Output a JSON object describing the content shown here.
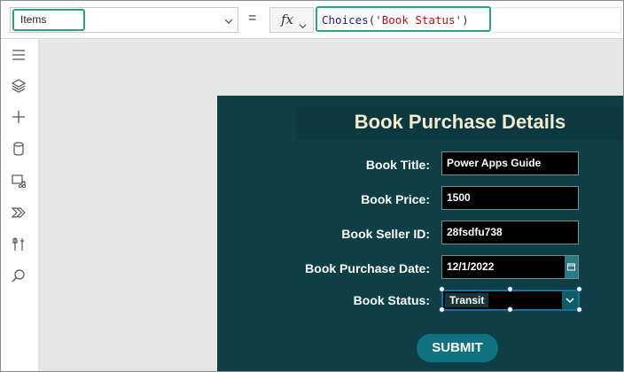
{
  "formula_bar": {
    "property_value": "Items",
    "equals": "=",
    "fx_label": "fx",
    "formula": {
      "function": "Choices",
      "open": "(",
      "argument": "'Book Status'",
      "close": ")"
    }
  },
  "left_rail": {
    "icons": [
      "menu-icon",
      "layers-icon",
      "add-icon",
      "data-icon",
      "media-icon",
      "power-automate-icon",
      "tools-icon",
      "search-icon"
    ]
  },
  "form": {
    "title": "Book Purchase Details",
    "fields": [
      {
        "label": "Book Title:",
        "value": "Power Apps Guide"
      },
      {
        "label": "Book Price:",
        "value": "1500"
      },
      {
        "label": "Book Seller ID:",
        "value": "28fsdfu738"
      },
      {
        "label": "Book Purchase Date:",
        "value": "12/1/2022"
      },
      {
        "label": "Book Status:",
        "value": "Transit"
      }
    ],
    "submit_label": "SUBMIT"
  },
  "colors": {
    "accent": "#2f9e83",
    "screen_bg": "#0e3f47",
    "title_text": "#f3ecce",
    "button_bg": "#11727f",
    "canvas_bg": "#e6e6e6"
  }
}
